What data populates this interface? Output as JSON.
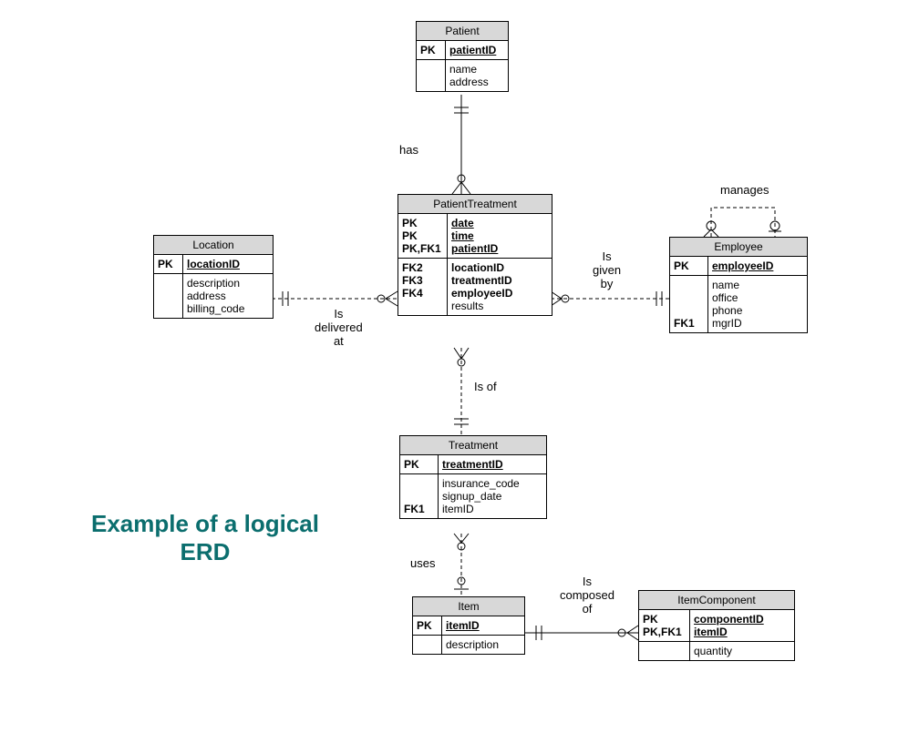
{
  "caption": "Example of a logical ERD",
  "entities": {
    "patient": {
      "title": "Patient",
      "pk_label": "PK",
      "pk_attr": "patientID",
      "attrs": [
        "name",
        "address"
      ]
    },
    "location": {
      "title": "Location",
      "pk_label": "PK",
      "pk_attr": "locationID",
      "attrs": [
        "description",
        "address",
        "billing_code"
      ]
    },
    "employee": {
      "title": "Employee",
      "pk_label": "PK",
      "pk_attr": "employeeID",
      "attrs": [
        "name",
        "office",
        "phone"
      ],
      "fk_label": "FK1",
      "fk_attr": "mgrID"
    },
    "patientTreatment": {
      "title": "PatientTreatment",
      "pk_labels": [
        "PK",
        "PK",
        "PK,FK1"
      ],
      "pk_attrs": [
        "date",
        "time",
        "patientID"
      ],
      "fk_labels": [
        "FK2",
        "FK3",
        "FK4",
        ""
      ],
      "fk_attrs_bold": [
        "locationID",
        "treatmentID",
        "employeeID"
      ],
      "fk_attr_plain": "results"
    },
    "treatment": {
      "title": "Treatment",
      "pk_label": "PK",
      "pk_attr": "treatmentID",
      "attrs": [
        "insurance_code",
        "signup_date"
      ],
      "fk_label": "FK1",
      "fk_attr": "itemID"
    },
    "item": {
      "title": "Item",
      "pk_label": "PK",
      "pk_attr": "itemID",
      "attrs": [
        "description"
      ]
    },
    "itemComponent": {
      "title": "ItemComponent",
      "pk_labels": [
        "PK",
        "PK,FK1"
      ],
      "pk_attrs": [
        "componentID",
        "itemID"
      ],
      "attrs": [
        "quantity"
      ]
    }
  },
  "relationships": {
    "has": "has",
    "delivered": "Is\ndelivered\nat",
    "given": "Is\ngiven\nby",
    "manages": "manages",
    "isof": "Is of",
    "uses": "uses",
    "composed": "Is\ncomposed\nof"
  }
}
